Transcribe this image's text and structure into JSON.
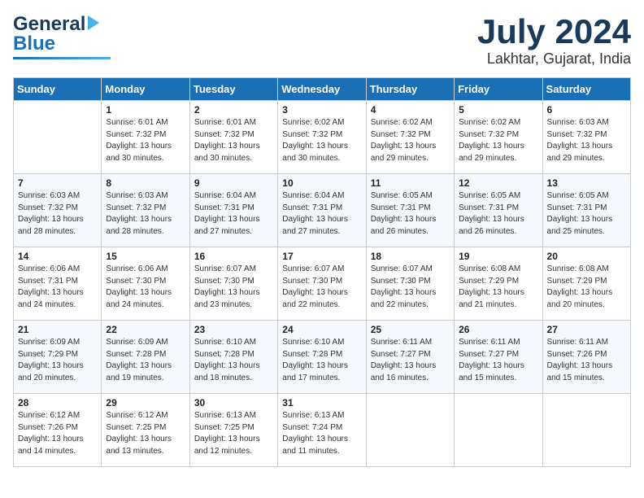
{
  "logo": {
    "line1": "General",
    "line2": "Blue"
  },
  "title": "July 2024",
  "subtitle": "Lakhtar, Gujarat, India",
  "days_of_week": [
    "Sunday",
    "Monday",
    "Tuesday",
    "Wednesday",
    "Thursday",
    "Friday",
    "Saturday"
  ],
  "weeks": [
    [
      {
        "day": "",
        "info": ""
      },
      {
        "day": "1",
        "info": "Sunrise: 6:01 AM\nSunset: 7:32 PM\nDaylight: 13 hours\nand 30 minutes."
      },
      {
        "day": "2",
        "info": "Sunrise: 6:01 AM\nSunset: 7:32 PM\nDaylight: 13 hours\nand 30 minutes."
      },
      {
        "day": "3",
        "info": "Sunrise: 6:02 AM\nSunset: 7:32 PM\nDaylight: 13 hours\nand 30 minutes."
      },
      {
        "day": "4",
        "info": "Sunrise: 6:02 AM\nSunset: 7:32 PM\nDaylight: 13 hours\nand 29 minutes."
      },
      {
        "day": "5",
        "info": "Sunrise: 6:02 AM\nSunset: 7:32 PM\nDaylight: 13 hours\nand 29 minutes."
      },
      {
        "day": "6",
        "info": "Sunrise: 6:03 AM\nSunset: 7:32 PM\nDaylight: 13 hours\nand 29 minutes."
      }
    ],
    [
      {
        "day": "7",
        "info": "Sunrise: 6:03 AM\nSunset: 7:32 PM\nDaylight: 13 hours\nand 28 minutes."
      },
      {
        "day": "8",
        "info": "Sunrise: 6:03 AM\nSunset: 7:32 PM\nDaylight: 13 hours\nand 28 minutes."
      },
      {
        "day": "9",
        "info": "Sunrise: 6:04 AM\nSunset: 7:31 PM\nDaylight: 13 hours\nand 27 minutes."
      },
      {
        "day": "10",
        "info": "Sunrise: 6:04 AM\nSunset: 7:31 PM\nDaylight: 13 hours\nand 27 minutes."
      },
      {
        "day": "11",
        "info": "Sunrise: 6:05 AM\nSunset: 7:31 PM\nDaylight: 13 hours\nand 26 minutes."
      },
      {
        "day": "12",
        "info": "Sunrise: 6:05 AM\nSunset: 7:31 PM\nDaylight: 13 hours\nand 26 minutes."
      },
      {
        "day": "13",
        "info": "Sunrise: 6:05 AM\nSunset: 7:31 PM\nDaylight: 13 hours\nand 25 minutes."
      }
    ],
    [
      {
        "day": "14",
        "info": "Sunrise: 6:06 AM\nSunset: 7:31 PM\nDaylight: 13 hours\nand 24 minutes."
      },
      {
        "day": "15",
        "info": "Sunrise: 6:06 AM\nSunset: 7:30 PM\nDaylight: 13 hours\nand 24 minutes."
      },
      {
        "day": "16",
        "info": "Sunrise: 6:07 AM\nSunset: 7:30 PM\nDaylight: 13 hours\nand 23 minutes."
      },
      {
        "day": "17",
        "info": "Sunrise: 6:07 AM\nSunset: 7:30 PM\nDaylight: 13 hours\nand 22 minutes."
      },
      {
        "day": "18",
        "info": "Sunrise: 6:07 AM\nSunset: 7:30 PM\nDaylight: 13 hours\nand 22 minutes."
      },
      {
        "day": "19",
        "info": "Sunrise: 6:08 AM\nSunset: 7:29 PM\nDaylight: 13 hours\nand 21 minutes."
      },
      {
        "day": "20",
        "info": "Sunrise: 6:08 AM\nSunset: 7:29 PM\nDaylight: 13 hours\nand 20 minutes."
      }
    ],
    [
      {
        "day": "21",
        "info": "Sunrise: 6:09 AM\nSunset: 7:29 PM\nDaylight: 13 hours\nand 20 minutes."
      },
      {
        "day": "22",
        "info": "Sunrise: 6:09 AM\nSunset: 7:28 PM\nDaylight: 13 hours\nand 19 minutes."
      },
      {
        "day": "23",
        "info": "Sunrise: 6:10 AM\nSunset: 7:28 PM\nDaylight: 13 hours\nand 18 minutes."
      },
      {
        "day": "24",
        "info": "Sunrise: 6:10 AM\nSunset: 7:28 PM\nDaylight: 13 hours\nand 17 minutes."
      },
      {
        "day": "25",
        "info": "Sunrise: 6:11 AM\nSunset: 7:27 PM\nDaylight: 13 hours\nand 16 minutes."
      },
      {
        "day": "26",
        "info": "Sunrise: 6:11 AM\nSunset: 7:27 PM\nDaylight: 13 hours\nand 15 minutes."
      },
      {
        "day": "27",
        "info": "Sunrise: 6:11 AM\nSunset: 7:26 PM\nDaylight: 13 hours\nand 15 minutes."
      }
    ],
    [
      {
        "day": "28",
        "info": "Sunrise: 6:12 AM\nSunset: 7:26 PM\nDaylight: 13 hours\nand 14 minutes."
      },
      {
        "day": "29",
        "info": "Sunrise: 6:12 AM\nSunset: 7:25 PM\nDaylight: 13 hours\nand 13 minutes."
      },
      {
        "day": "30",
        "info": "Sunrise: 6:13 AM\nSunset: 7:25 PM\nDaylight: 13 hours\nand 12 minutes."
      },
      {
        "day": "31",
        "info": "Sunrise: 6:13 AM\nSunset: 7:24 PM\nDaylight: 13 hours\nand 11 minutes."
      },
      {
        "day": "",
        "info": ""
      },
      {
        "day": "",
        "info": ""
      },
      {
        "day": "",
        "info": ""
      }
    ]
  ]
}
